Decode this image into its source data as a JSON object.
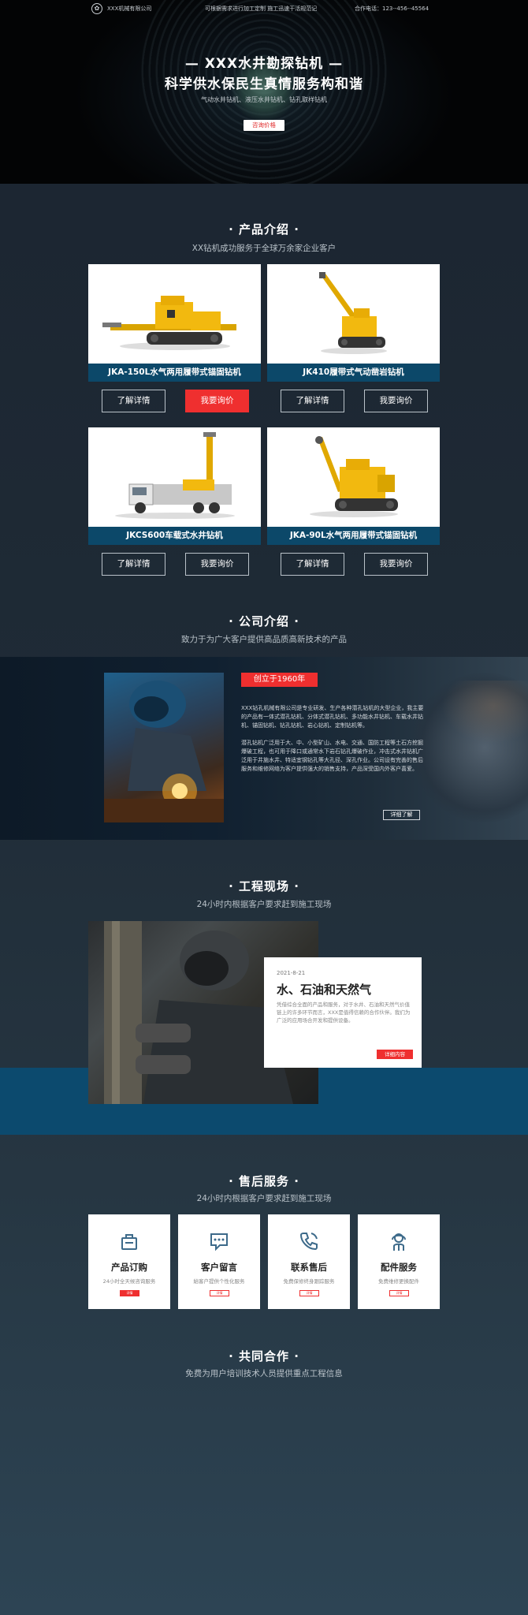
{
  "header": {
    "company_name": "XXX机械有限公司",
    "slogan": "可根据需求进行加工定制 施工迅速干活规范记",
    "phone_label": "合作电话：123--456--45564"
  },
  "hero": {
    "title_line1": "—  XXX水井勘探钻机  —",
    "title_line2": "科学供水保民生真情服务构和谐",
    "subtitle": "气动水井钻机、液压水井钻机、钻孔取样钻机",
    "cta_label": "咨询价格"
  },
  "products": {
    "title": "·  产品介绍  ·",
    "subtitle": "XX钻机成功服务于全球万余家企业客户",
    "items": [
      {
        "name": "JKA-150L水气两用履带式锚固钻机",
        "details_label": "了解详情",
        "inquiry_label": "我要询价"
      },
      {
        "name": "JK410履带式气动凿岩钻机",
        "details_label": "了解详情",
        "inquiry_label": "我要询价"
      },
      {
        "name": "JKCS600车载式水井钻机",
        "details_label": "了解详情",
        "inquiry_label": "我要询价"
      },
      {
        "name": "JKA-90L水气两用履带式锚固钻机",
        "details_label": "了解详情",
        "inquiry_label": "我要询价"
      }
    ]
  },
  "company": {
    "title": "·  公司介绍  ·",
    "subtitle": "致力于为广大客户提供高品质高新技术的产品",
    "badge": "创立于1960年",
    "paragraph1": "XXX钻孔机械有限公司是专业研发、生产各种潜孔钻机的大型企业，我主要的产品有一体式潜孔钻机、分体式潜孔钻机、多功能水井钻机、车载水井钻机、锚固钻机、钻孔钻机、岩心钻机、定制钻机等。",
    "paragraph2": "潜孔钻机广泛用于大、中、小型矿山、水电、交通、国防工程等土石方挖掘爆破工程，也可用于降口或通常水下岩石钻孔爆破作业，冲击式水井钻机广泛用于井施水井、特适宜钢钻孔等大孔径、深孔作业。公司设有完善的售后服务和维修网络为客户提供强大的销售支持，产品深受国内外客户喜爱。",
    "more_label": "详细了解"
  },
  "projects": {
    "title": "·  工程现场  ·",
    "subtitle": "24小时内根据客户要求赶到施工现场",
    "date": "2021-8-21",
    "headline": "水、石油和天然气",
    "text": "凭借综合全面的产品和服务，对于水井、石油和天然气价值链上的许多环节而言，XXX是值得信赖的合作伙伴。我们为广泛的应用场合开发和提供设备。",
    "details_label": "详细内容"
  },
  "service": {
    "title": "·  售后服务  ·",
    "subtitle": "24小时内根据客户要求赶到施工现场",
    "items": [
      {
        "icon": "shopping-bag-icon",
        "title": "产品订购",
        "desc": "24小时全天候咨询服务",
        "btn": "详情"
      },
      {
        "icon": "chat-message-icon",
        "title": "客户留言",
        "desc": "給客户提供个性化服务",
        "btn": "详情"
      },
      {
        "icon": "phone-icon",
        "title": "联系售后",
        "desc": "免费保修终身跟踪服务",
        "btn": "详情"
      },
      {
        "icon": "support-agent-icon",
        "title": "配件服务",
        "desc": "免费维修更换配件",
        "btn": "详情"
      }
    ]
  },
  "cooperation": {
    "title": "·  共同合作  ·",
    "subtitle": "免费为用户培训技术人员提供重点工程信息"
  }
}
